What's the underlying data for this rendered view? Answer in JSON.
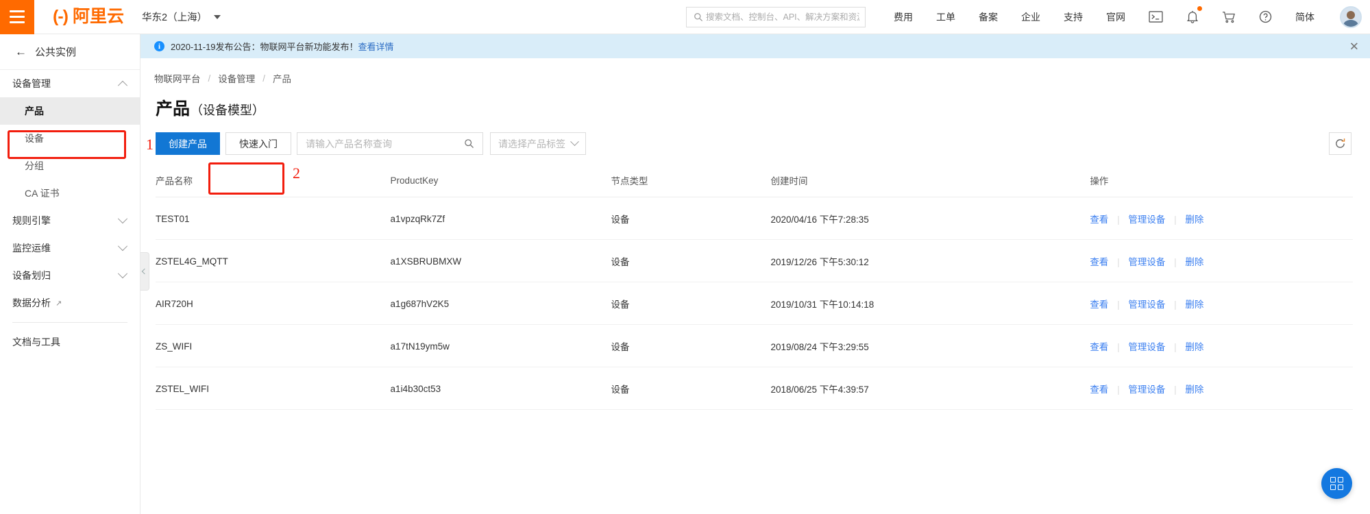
{
  "header": {
    "menu_icon": "hamburger-icon",
    "brand_mark": "(-)",
    "brand_text": "阿里云",
    "region": "华东2（上海）",
    "search_placeholder": "搜索文档、控制台、API、解决方案和资源",
    "search_value": "",
    "nav_items": [
      {
        "label": "费用",
        "name": "topnav-billing"
      },
      {
        "label": "工单",
        "name": "topnav-ticket"
      },
      {
        "label": "备案",
        "name": "topnav-icp"
      },
      {
        "label": "企业",
        "name": "topnav-enterprise"
      },
      {
        "label": "支持",
        "name": "topnav-support"
      },
      {
        "label": "官网",
        "name": "topnav-website"
      }
    ],
    "lang": "简体",
    "icons": {
      "terminal": "terminal-icon",
      "bell": "bell-icon",
      "cart": "cart-icon",
      "help": "help-icon"
    }
  },
  "sidebar": {
    "back_label": "公共实例",
    "groups": [
      {
        "label": "设备管理",
        "expanded": true,
        "items": [
          {
            "label": "产品",
            "active": true
          },
          {
            "label": "设备",
            "active": false
          },
          {
            "label": "分组",
            "active": false
          },
          {
            "label": "CA 证书",
            "active": false
          }
        ]
      },
      {
        "label": "规则引擎",
        "expanded": false,
        "items": []
      },
      {
        "label": "监控运维",
        "expanded": false,
        "items": []
      },
      {
        "label": "设备划归",
        "expanded": false,
        "items": []
      }
    ],
    "external_item": {
      "label": "数据分析",
      "external": true
    },
    "footer_item": {
      "label": "文档与工具"
    }
  },
  "annotations": [
    {
      "number": "1",
      "target": "sidebar-item-product"
    },
    {
      "number": "2",
      "target": "create-product-button"
    }
  ],
  "notice": {
    "text": "2020-11-19发布公告：物联网平台新功能发布！",
    "link": "查看详情",
    "close": "✕"
  },
  "breadcrumb": [
    "物联网平台",
    "设备管理",
    "产品"
  ],
  "page": {
    "title": "产品",
    "subtitle": "（设备模型）"
  },
  "toolbar": {
    "create_label": "创建产品",
    "quickstart_label": "快速入门",
    "search_placeholder": "请输入产品名称查询",
    "search_value": "",
    "tag_select_label": "请选择产品标签",
    "refresh_icon": "refresh-icon"
  },
  "table": {
    "columns": [
      "产品名称",
      "ProductKey",
      "节点类型",
      "创建时间",
      "操作"
    ],
    "ops": {
      "view": "查看",
      "manage": "管理设备",
      "delete": "删除",
      "sep": "|"
    },
    "rows": [
      {
        "name": "TEST01",
        "key": "a1vpzqRk7Zf",
        "node": "设备",
        "time": "2020/04/16 下午7:28:35"
      },
      {
        "name": "ZSTEL4G_MQTT",
        "key": "a1XSBRUBMXW",
        "node": "设备",
        "time": "2019/12/26 下午5:30:12"
      },
      {
        "name": "AIR720H",
        "key": "a1g687hV2K5",
        "node": "设备",
        "time": "2019/10/31 下午10:14:18"
      },
      {
        "name": "ZS_WIFI",
        "key": "a17tN19ym5w",
        "node": "设备",
        "time": "2019/08/24 下午3:29:55"
      },
      {
        "name": "ZSTEL_WIFI",
        "key": "a1i4b30ct53",
        "node": "设备",
        "time": "2018/06/25 下午4:39:57"
      }
    ]
  },
  "fab": {
    "icon": "grid-icon"
  },
  "colors": {
    "brand_orange": "#ff6a00",
    "primary_blue": "#1277d4",
    "link_blue": "#3b7ff0",
    "notice_bg": "#d9edf9",
    "annotation_red": "#f21d0d"
  }
}
